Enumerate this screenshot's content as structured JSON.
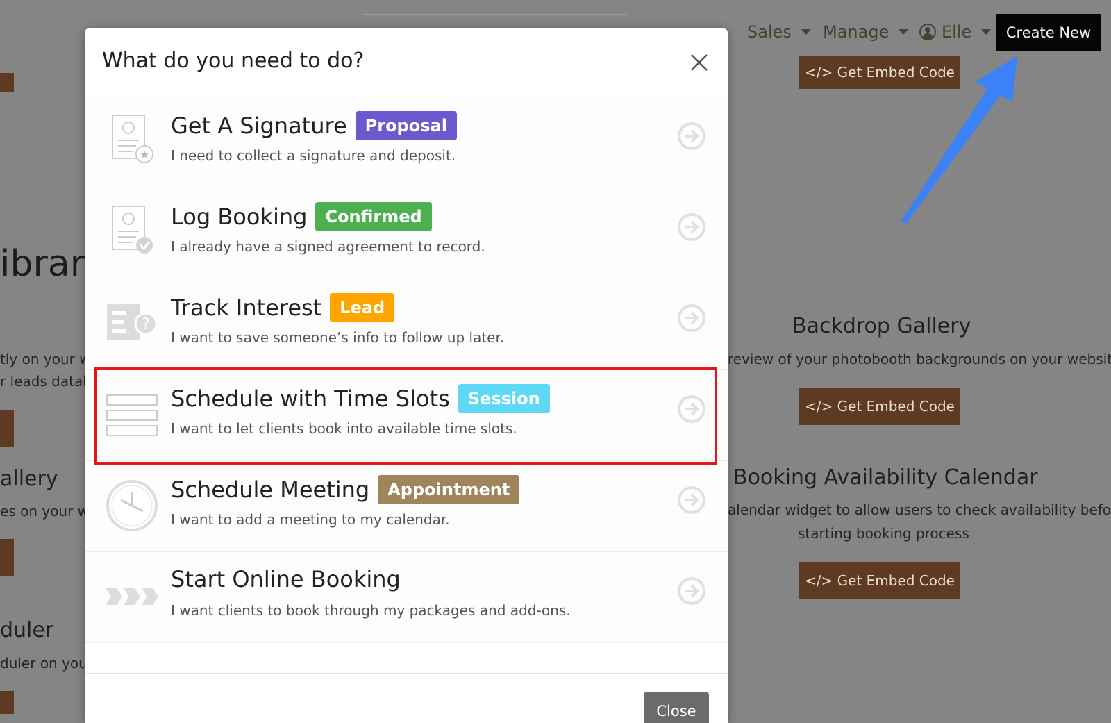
{
  "nav": {
    "sales": "Sales",
    "manage": "Manage",
    "user": "Elle",
    "create_new": "Create New"
  },
  "background": {
    "library_fragment": "ibrary",
    "left_line1": "tly on your w",
    "left_line2": "r leads datab",
    "gallery_fragment": "allery",
    "gallery_desc": "es on your w",
    "scheduler_fragment": "duler",
    "scheduler_desc": "duler on you",
    "backdrop_title": "Backdrop Gallery",
    "backdrop_desc": "review of your photobooth backgrounds on your website",
    "embed_label": "</> Get Embed Code",
    "calendar_title": "Booking Availability Calendar",
    "calendar_desc1": "alendar widget to allow users to check availability before",
    "calendar_desc2": "starting booking process"
  },
  "modal": {
    "title": "What do you need to do?",
    "close_label": "Close",
    "options": [
      {
        "title": "Get A Signature",
        "badge": "Proposal",
        "badge_color": "#6a5acd",
        "desc": "I need to collect a signature and deposit.",
        "icon": "signature-document-icon"
      },
      {
        "title": "Log Booking",
        "badge": "Confirmed",
        "badge_color": "#4caf50",
        "desc": "I already have a signed agreement to record.",
        "icon": "checked-document-icon"
      },
      {
        "title": "Track Interest",
        "badge": "Lead",
        "badge_color": "#ffa500",
        "desc": "I want to save someone’s info to follow up later.",
        "icon": "form-question-icon"
      },
      {
        "title": "Schedule with Time Slots",
        "badge": "Session",
        "badge_color": "#5dd9f5",
        "desc": "I want to let clients book into available time slots.",
        "icon": "time-slots-icon"
      },
      {
        "title": "Schedule Meeting",
        "badge": "Appointment",
        "badge_color": "#a0845c",
        "desc": "I want to add a meeting to my calendar.",
        "icon": "clock-icon"
      },
      {
        "title": "Start Online Booking",
        "badge": "",
        "badge_color": "",
        "desc": "I want clients to book through my packages and add-ons.",
        "icon": "chevrons-icon"
      }
    ]
  },
  "colors": {
    "highlight": "#e8141b",
    "annotation_arrow": "#3b82f6"
  }
}
